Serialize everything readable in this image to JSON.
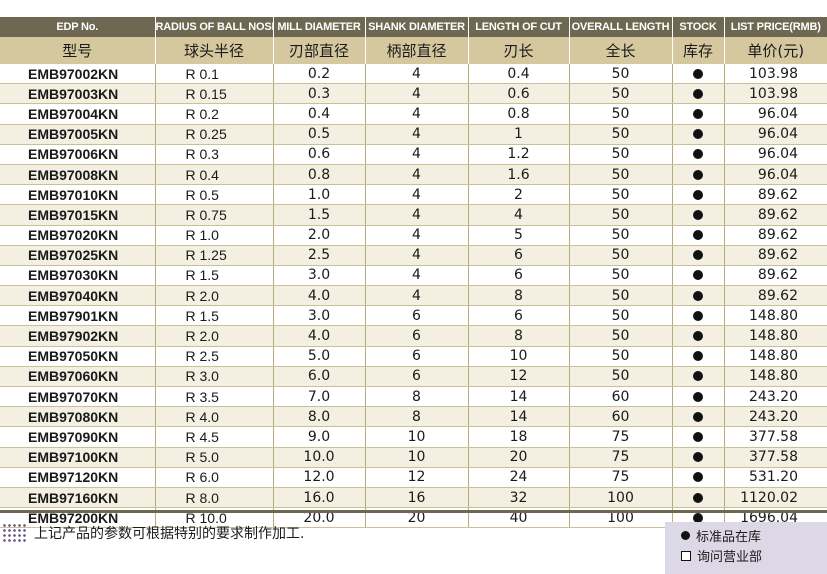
{
  "columns_en": [
    "EDP No.",
    "RADIUS OF BALL NOSE",
    "MILL DIAMETER",
    "SHANK DIAMETER",
    "LENGTH OF CUT",
    "OVERALL LENGTH",
    "STOCK",
    "LIST PRICE(RMB)"
  ],
  "columns_zh": [
    "型号",
    "球头半径",
    "刃部直径",
    "柄部直径",
    "刃长",
    "全长",
    "库存",
    "单价(元)"
  ],
  "rows": [
    {
      "edp": "EMB97002KN",
      "radius": "R 0.1",
      "mill": "0.2",
      "shank": "4",
      "cut": "0.4",
      "overall": "50",
      "stock": "in-stock",
      "price": "103.98"
    },
    {
      "edp": "EMB97003KN",
      "radius": "R 0.15",
      "mill": "0.3",
      "shank": "4",
      "cut": "0.6",
      "overall": "50",
      "stock": "in-stock",
      "price": "103.98"
    },
    {
      "edp": "EMB97004KN",
      "radius": "R 0.2",
      "mill": "0.4",
      "shank": "4",
      "cut": "0.8",
      "overall": "50",
      "stock": "in-stock",
      "price": "96.04"
    },
    {
      "edp": "EMB97005KN",
      "radius": "R 0.25",
      "mill": "0.5",
      "shank": "4",
      "cut": "1",
      "overall": "50",
      "stock": "in-stock",
      "price": "96.04"
    },
    {
      "edp": "EMB97006KN",
      "radius": "R 0.3",
      "mill": "0.6",
      "shank": "4",
      "cut": "1.2",
      "overall": "50",
      "stock": "in-stock",
      "price": "96.04"
    },
    {
      "edp": "EMB97008KN",
      "radius": "R 0.4",
      "mill": "0.8",
      "shank": "4",
      "cut": "1.6",
      "overall": "50",
      "stock": "in-stock",
      "price": "96.04"
    },
    {
      "edp": "EMB97010KN",
      "radius": "R 0.5",
      "mill": "1.0",
      "shank": "4",
      "cut": "2",
      "overall": "50",
      "stock": "in-stock",
      "price": "89.62"
    },
    {
      "edp": "EMB97015KN",
      "radius": "R 0.75",
      "mill": "1.5",
      "shank": "4",
      "cut": "4",
      "overall": "50",
      "stock": "in-stock",
      "price": "89.62"
    },
    {
      "edp": "EMB97020KN",
      "radius": "R 1.0",
      "mill": "2.0",
      "shank": "4",
      "cut": "5",
      "overall": "50",
      "stock": "in-stock",
      "price": "89.62"
    },
    {
      "edp": "EMB97025KN",
      "radius": "R 1.25",
      "mill": "2.5",
      "shank": "4",
      "cut": "6",
      "overall": "50",
      "stock": "in-stock",
      "price": "89.62"
    },
    {
      "edp": "EMB97030KN",
      "radius": "R 1.5",
      "mill": "3.0",
      "shank": "4",
      "cut": "6",
      "overall": "50",
      "stock": "in-stock",
      "price": "89.62"
    },
    {
      "edp": "EMB97040KN",
      "radius": "R 2.0",
      "mill": "4.0",
      "shank": "4",
      "cut": "8",
      "overall": "50",
      "stock": "in-stock",
      "price": "89.62"
    },
    {
      "edp": "EMB97901KN",
      "radius": "R 1.5",
      "mill": "3.0",
      "shank": "6",
      "cut": "6",
      "overall": "50",
      "stock": "in-stock",
      "price": "148.80"
    },
    {
      "edp": "EMB97902KN",
      "radius": "R 2.0",
      "mill": "4.0",
      "shank": "6",
      "cut": "8",
      "overall": "50",
      "stock": "in-stock",
      "price": "148.80"
    },
    {
      "edp": "EMB97050KN",
      "radius": "R 2.5",
      "mill": "5.0",
      "shank": "6",
      "cut": "10",
      "overall": "50",
      "stock": "in-stock",
      "price": "148.80"
    },
    {
      "edp": "EMB97060KN",
      "radius": "R 3.0",
      "mill": "6.0",
      "shank": "6",
      "cut": "12",
      "overall": "50",
      "stock": "in-stock",
      "price": "148.80"
    },
    {
      "edp": "EMB97070KN",
      "radius": "R 3.5",
      "mill": "7.0",
      "shank": "8",
      "cut": "14",
      "overall": "60",
      "stock": "in-stock",
      "price": "243.20"
    },
    {
      "edp": "EMB97080KN",
      "radius": "R 4.0",
      "mill": "8.0",
      "shank": "8",
      "cut": "14",
      "overall": "60",
      "stock": "in-stock",
      "price": "243.20"
    },
    {
      "edp": "EMB97090KN",
      "radius": "R 4.5",
      "mill": "9.0",
      "shank": "10",
      "cut": "18",
      "overall": "75",
      "stock": "in-stock",
      "price": "377.58"
    },
    {
      "edp": "EMB97100KN",
      "radius": "R 5.0",
      "mill": "10.0",
      "shank": "10",
      "cut": "20",
      "overall": "75",
      "stock": "in-stock",
      "price": "377.58"
    },
    {
      "edp": "EMB97120KN",
      "radius": "R 6.0",
      "mill": "12.0",
      "shank": "12",
      "cut": "24",
      "overall": "75",
      "stock": "in-stock",
      "price": "531.20"
    },
    {
      "edp": "EMB97160KN",
      "radius": "R 8.0",
      "mill": "16.0",
      "shank": "16",
      "cut": "32",
      "overall": "100",
      "stock": "in-stock",
      "price": "1120.02"
    },
    {
      "edp": "EMB97200KN",
      "radius": "R 10.0",
      "mill": "20.0",
      "shank": "20",
      "cut": "40",
      "overall": "100",
      "stock": "in-stock",
      "price": "1696.04"
    }
  ],
  "footnote": "上记产品的参数可根据特别的要求制作加工.",
  "legend": {
    "in_stock": "标准品在库",
    "inquire": "询问营业部"
  },
  "colors": {
    "header_dark": "#6e6752",
    "header_light": "#d6c89e",
    "row_alt": "#f3efe1",
    "legend_bg": "#ddd8e6"
  }
}
